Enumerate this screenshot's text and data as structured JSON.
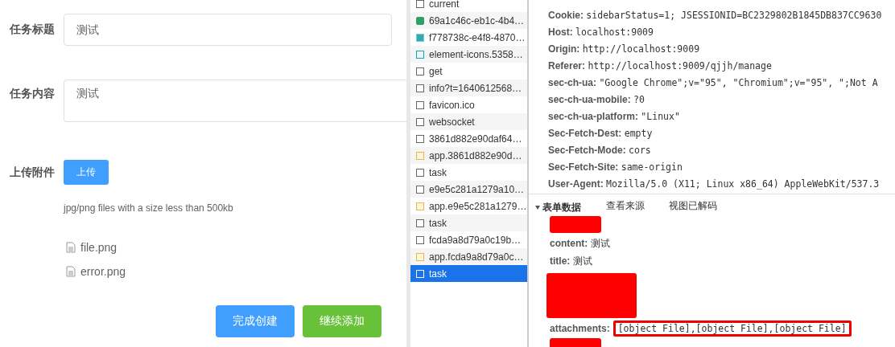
{
  "form": {
    "fields": [
      {
        "kind": "input",
        "label": "任务标题",
        "value": "测试"
      },
      {
        "kind": "textarea",
        "label": "任务内容",
        "value": "测试"
      }
    ],
    "upload": {
      "label": "上传附件",
      "button": "上传",
      "hint": "jpg/png files with a size less than 500kb",
      "files": [
        "file.png",
        "error.png"
      ]
    },
    "buttons": [
      {
        "label": "完成创建",
        "kind": "primary"
      },
      {
        "label": "继续添加",
        "kind": "success"
      }
    ]
  },
  "requests": [
    {
      "name": "current",
      "kind": "doc",
      "selected": false
    },
    {
      "name": "69a1c46c-eb1c-4b4…",
      "kind": "image",
      "selected": false
    },
    {
      "name": "f778738c-e4f8-4870…",
      "kind": "image2",
      "selected": false
    },
    {
      "name": "element-icons.5358…",
      "kind": "font",
      "selected": false
    },
    {
      "name": "get",
      "kind": "doc",
      "selected": false
    },
    {
      "name": "info?t=1640612568…",
      "kind": "doc",
      "selected": false
    },
    {
      "name": "favicon.ico",
      "kind": "doc",
      "selected": false
    },
    {
      "name": "websocket",
      "kind": "doc",
      "selected": false
    },
    {
      "name": "3861d882e90daf64…",
      "kind": "doc",
      "selected": false
    },
    {
      "name": "app.3861d882e90d…",
      "kind": "script",
      "selected": false
    },
    {
      "name": "task",
      "kind": "doc",
      "selected": false
    },
    {
      "name": "e9e5c281a1279a10…",
      "kind": "doc",
      "selected": false
    },
    {
      "name": "app.e9e5c281a1279…",
      "kind": "script",
      "selected": false
    },
    {
      "name": "task",
      "kind": "doc",
      "selected": false
    },
    {
      "name": "fcda9a8d79a0c19b…",
      "kind": "doc",
      "selected": false
    },
    {
      "name": "app.fcda9a8d79a0c…",
      "kind": "script",
      "selected": false
    },
    {
      "name": "task",
      "kind": "doc",
      "selected": true
    }
  ],
  "headers": [
    {
      "name": "Cookie:",
      "value": "sidebarStatus=1; JSESSIONID=BC2329802B1845DB837CC9630"
    },
    {
      "name": "Host:",
      "value": "localhost:9009"
    },
    {
      "name": "Origin:",
      "value": "http://localhost:9009"
    },
    {
      "name": "Referer:",
      "value": "http://localhost:9009/qjjh/manage"
    },
    {
      "name": "sec-ch-ua:",
      "value": "\"Google Chrome\";v=\"95\", \"Chromium\";v=\"95\", \";Not A"
    },
    {
      "name": "sec-ch-ua-mobile:",
      "value": "?0"
    },
    {
      "name": "sec-ch-ua-platform:",
      "value": "\"Linux\""
    },
    {
      "name": "Sec-Fetch-Dest:",
      "value": "empty"
    },
    {
      "name": "Sec-Fetch-Mode:",
      "value": "cors"
    },
    {
      "name": "Sec-Fetch-Site:",
      "value": "same-origin"
    },
    {
      "name": "User-Agent:",
      "value": "Mozilla/5.0 (X11; Linux x86_64) AppleWebKit/537.3"
    }
  ],
  "form_data": {
    "title": "表单数据",
    "expanded": true,
    "links": [
      "查看来源",
      "视图已解码"
    ],
    "entries": [
      {
        "kind": "redacted",
        "large": false
      },
      {
        "kind": "field",
        "name": "content:",
        "value": "测试"
      },
      {
        "kind": "field",
        "name": "title:",
        "value": "测试"
      },
      {
        "kind": "redacted",
        "large": true
      },
      {
        "kind": "field",
        "name": "attachments:",
        "value": "[object File],[object File],[object File]",
        "highlighted": true
      },
      {
        "kind": "redacted",
        "large": false
      }
    ]
  }
}
